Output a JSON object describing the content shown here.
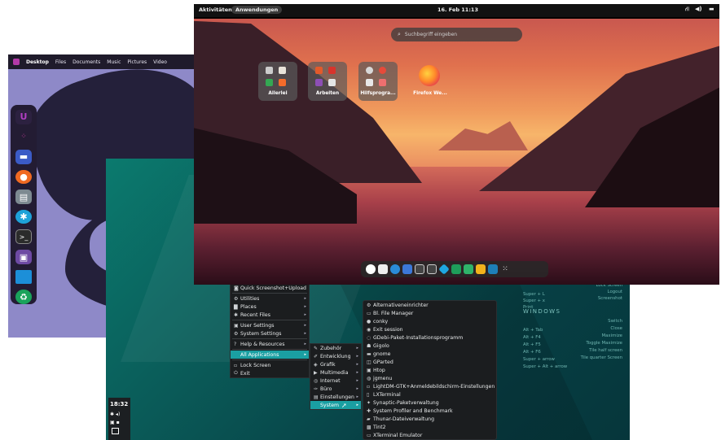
{
  "desktop1": {
    "topbar": {
      "items": [
        "Desktop",
        "Files",
        "Documents",
        "Music",
        "Pictures",
        "Video"
      ]
    },
    "dock": {
      "icons": [
        "ubuntu-logo-icon",
        "grid-icon",
        "files-icon",
        "firefox-icon",
        "archive-icon",
        "settings-icon",
        "terminal-icon",
        "monitor-icon",
        "window-icon",
        "recycle-icon"
      ]
    }
  },
  "desktop2": {
    "clock": "18:32",
    "shortcuts_top": [
      {
        "key": "Super + L",
        "action": "Lock Screen"
      },
      {
        "key": "Super + x",
        "action": "Logout"
      },
      {
        "key": "Print",
        "action": "Screenshot"
      }
    ],
    "windows_heading": "WINDOWS",
    "shortcuts_windows": [
      {
        "key": "Alt + Tab",
        "action": "Switch"
      },
      {
        "key": "Alt + F4",
        "action": "Close"
      },
      {
        "key": "Alt + F5",
        "action": "Maximize"
      },
      {
        "key": "Alt + F6",
        "action": "Toggle Maximize"
      },
      {
        "key": "Super + arrow",
        "action": "Tile half screen"
      },
      {
        "key": "Super + Alt + arrow",
        "action": "Tile quarter Screen"
      }
    ],
    "main_menu": [
      "Quick Screenshot+Upload",
      "Utilities",
      "Places",
      "Recent Files",
      "User Settings",
      "System Settings",
      "Help & Resources",
      "All Applications",
      "Lock Screen",
      "Exit"
    ],
    "apps_menu": [
      "Zubehör",
      "Entwicklung",
      "Grafik",
      "Multimedia",
      "Internet",
      "Büro",
      "Einstellungen",
      "System"
    ],
    "system_menu": [
      "Alternativeneinrichter",
      "Bl. File Manager",
      "conky",
      "Exit session",
      "GDebi-Paket-Installationsprogramm",
      "Gigolo",
      "gnome",
      "GParted",
      "Htop",
      "jgmenu",
      "LightDM-GTK+Anmeldebildschirm-Einstellungen",
      "LXTerminal",
      "Synaptic-Paketverwaltung",
      "System Profiler and Benchmark",
      "Thunar-Dateiverwaltung",
      "Tint2",
      "XTerminal Emulator"
    ]
  },
  "desktop3": {
    "topbar": {
      "activities": "Aktivitäten",
      "apps": "Anwendungen",
      "datetime": "16. Feb 11:13"
    },
    "search": {
      "placeholder": "Suchbegriff eingeben"
    },
    "folders": [
      "Allerlei",
      "Arbeiten",
      "Hilfsprogra...",
      "Firefox We..."
    ],
    "dash_icons": [
      "settings-icon",
      "camera-icon",
      "browser-icon",
      "phone-icon",
      "window-icon",
      "window2-icon",
      "store-icon",
      "sheet-icon",
      "sheet2-icon",
      "folder-icon",
      "screen-icon",
      "apps-grid-icon"
    ]
  }
}
